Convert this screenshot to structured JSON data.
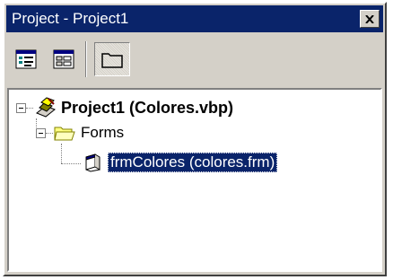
{
  "window": {
    "title": "Project - Project1"
  },
  "toolbar": {
    "buttons": [
      {
        "icon": "view-code-icon"
      },
      {
        "icon": "view-object-icon"
      },
      {
        "icon": "toggle-folders-icon",
        "pressed": true
      }
    ]
  },
  "tree": {
    "root": {
      "label": "Project1 (Colores.vbp)",
      "icon": "project-icon"
    },
    "folder": {
      "label": "Forms",
      "icon": "folder-open-icon"
    },
    "form": {
      "label": "frmColores (colores.frm)",
      "icon": "form-icon",
      "selected": true
    }
  },
  "colors": {
    "titlebar": "#0a246a",
    "selection": "#0a246a",
    "face": "#d4d0c8"
  }
}
